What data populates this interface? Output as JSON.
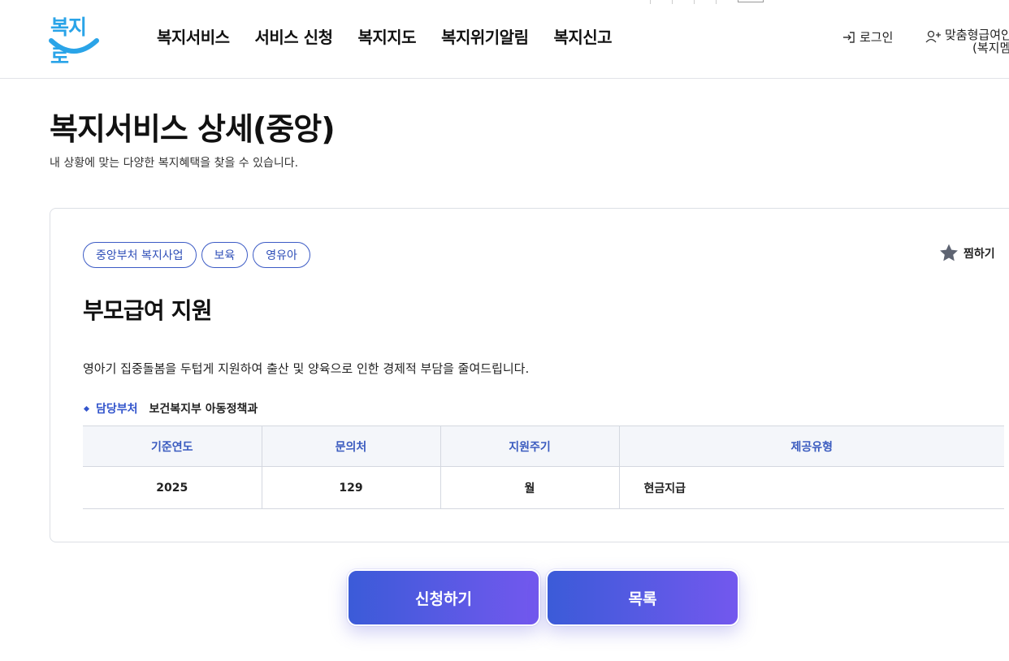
{
  "header": {
    "logo_text": "복지로",
    "nav": [
      "복지서비스",
      "서비스 신청",
      "복지지도",
      "복지위기알림",
      "복지신고"
    ],
    "login_label": "로그인",
    "custom_member_line1": "맞춤형급여안",
    "custom_member_line2": "(복지멤버십"
  },
  "page": {
    "title": "복지서비스 상세(중앙)",
    "description": "내 상황에 맞는 다양한 복지혜택을 찾을 수 있습니다."
  },
  "service": {
    "tags": [
      "중앙부처 복지사업",
      "보육",
      "영유아"
    ],
    "favorite_label": "찜하기",
    "title": "부모급여 지원",
    "description": "영아기 집중돌봄을 두텁게 지원하여 출산 및 양육으로 인한 경제적 부담을 줄여드립니다.",
    "dept_label": "담당부처",
    "dept_value": "보건복지부 아동정책과",
    "table": {
      "headers": [
        "기준연도",
        "문의처",
        "지원주기",
        "제공유형"
      ],
      "row": [
        "2025",
        "129",
        "월",
        "현금지급"
      ]
    }
  },
  "buttons": {
    "apply": "신청하기",
    "list": "목록"
  },
  "colors": {
    "accent_blue": "#3355cc",
    "logo_blue": "#2aa4e8",
    "button_gradient_start": "#3b5bd8",
    "button_gradient_end": "#7358ee"
  }
}
